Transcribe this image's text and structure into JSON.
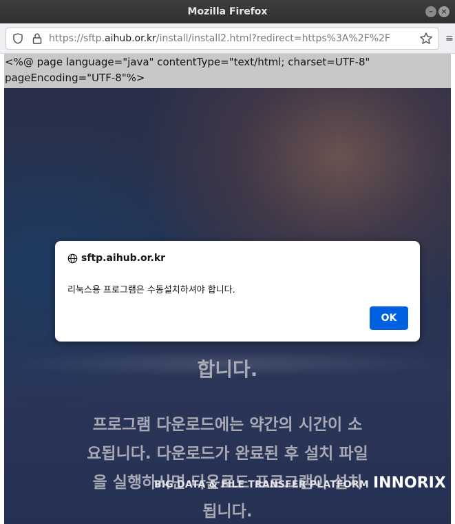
{
  "window": {
    "title": "Mozilla Firefox",
    "controls": [
      "minimize",
      "close"
    ]
  },
  "navbar": {
    "url_prefix": "https://sftp.",
    "url_domain": "aihub.or.kr",
    "url_path": "/install/install2.html?redirect=https%3A%2F%2F",
    "menu_glyph": "≡"
  },
  "page": {
    "jsp_line1": "<%@ page language=\"java\" contentType=\"text/html; charset=UTF-8\"",
    "jsp_line2": "pageEncoding=\"UTF-8\"%>",
    "text_lines": [
      "합니다.",
      "프로그램 다운로드에는 약간의 시간이 소",
      "요됩니다. 다운로드가 완료된 후 설치 파일",
      "을 실행하시면 다운로드 프로그램이 설치",
      "됩니다."
    ],
    "footer_text": "BIG DATA & FILE TRANSFER PLATFORM",
    "brand": "INNORIX"
  },
  "dialog": {
    "origin": "sftp.aihub.or.kr",
    "message": "리눅스용 프로그램은 수동설치하셔야 합니다.",
    "ok_label": "OK"
  },
  "colors": {
    "ok_button": "#0061e0",
    "titlebar": "#333333",
    "page_text": "#a9a9b4"
  }
}
